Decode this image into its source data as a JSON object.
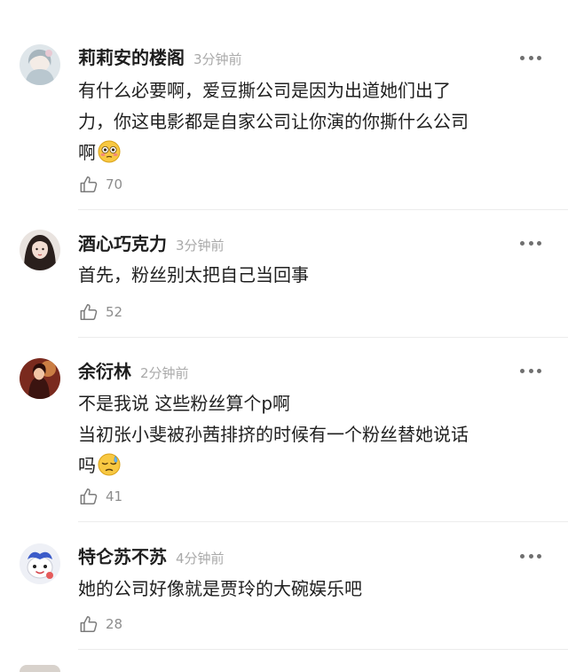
{
  "comments": [
    {
      "username": "莉莉安的楼阁",
      "time": "3分钟前",
      "lines": [
        "有什么必要啊，爱豆撕公司是因为出道她们出了",
        "力，你这电影都是自家公司让你演的你撕什么公司",
        "啊"
      ],
      "emoji": "flushed-face",
      "likes": "70"
    },
    {
      "username": "酒心巧克力",
      "time": "3分钟前",
      "lines": [
        "首先，粉丝别太把自己当回事"
      ],
      "likes": "52"
    },
    {
      "username": "余衍林",
      "time": "2分钟前",
      "lines": [
        "不是我说 这些粉丝算个p啊",
        "当初张小斐被孙茜排挤的时候有一个粉丝替她说话",
        "吗"
      ],
      "emoji": "downcast-sweat-face",
      "likes": "41"
    },
    {
      "username": "特仑苏不苏",
      "time": "4分钟前",
      "lines": [
        "她的公司好像就是贾玲的大碗娱乐吧"
      ],
      "likes": "28"
    }
  ],
  "icons": {
    "like": "thumbs-up-outline-icon",
    "more": "more-dots-icon"
  },
  "colors": {
    "username": "#1e1e1e",
    "time": "#a9a9a9",
    "body": "#1f1f1f",
    "meta": "#8d8d8d",
    "divider": "#ececec"
  }
}
